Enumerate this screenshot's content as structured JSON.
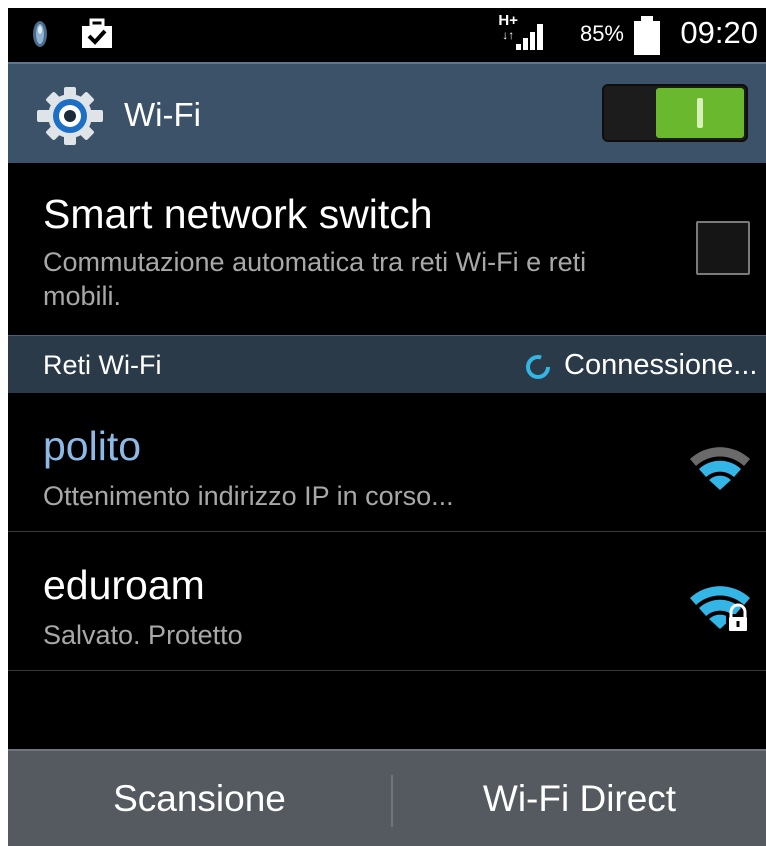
{
  "status_bar": {
    "network_type": "H+",
    "battery_percent": "85%",
    "time": "09:20",
    "icons": [
      "notification-app-icon",
      "briefcase-check-icon",
      "data-arrows-icon",
      "signal-icon",
      "battery-icon"
    ]
  },
  "title_bar": {
    "title": "Wi-Fi",
    "icon": "gear-icon",
    "toggle_on": true,
    "toggle_color": "#6ab82d"
  },
  "smart_switch": {
    "title": "Smart network switch",
    "description": "Commutazione automatica tra reti Wi-Fi e reti mobili.",
    "checked": false
  },
  "section": {
    "title": "Reti Wi-Fi",
    "status": "Connessione..."
  },
  "networks": [
    {
      "name": "polito",
      "status": "Ottenimento indirizzo IP in corso...",
      "name_color": "#8db9e6",
      "icon": "wifi-partial-signal-icon",
      "secured": false
    },
    {
      "name": "eduroam",
      "status": "Salvato. Protetto",
      "name_color": "#ffffff",
      "icon": "wifi-lock-icon",
      "secured": true
    }
  ],
  "bottom_bar": {
    "scan_label": "Scansione",
    "direct_label": "Wi-Fi Direct"
  },
  "colors": {
    "accent_blue": "#33b5e5",
    "title_bar_bg": "#3c5268",
    "section_bg": "#2b3a48"
  }
}
